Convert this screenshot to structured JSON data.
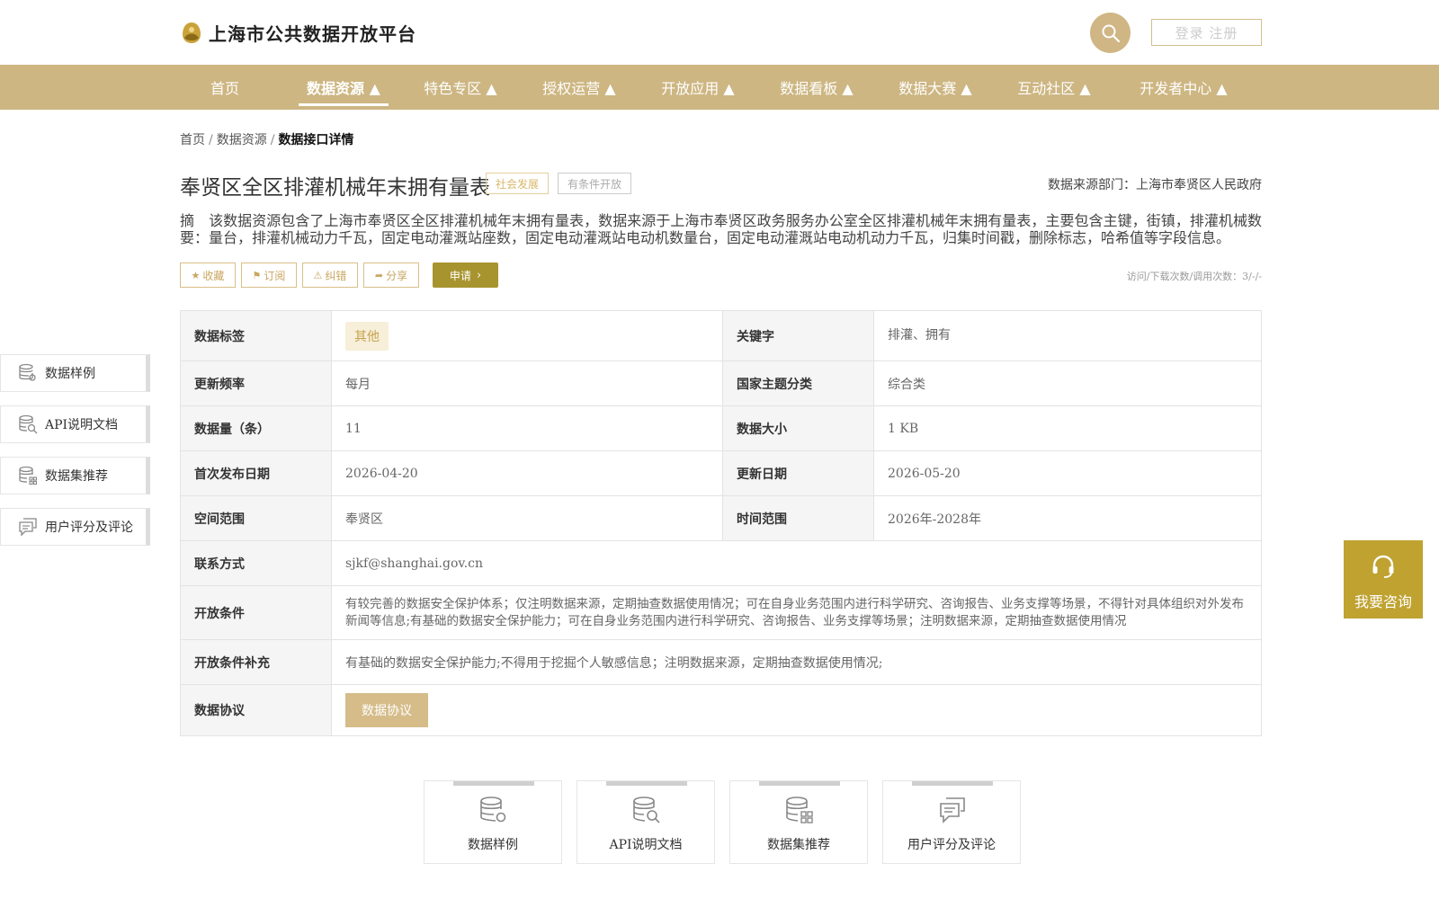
{
  "header": {
    "platform_name": "上海市公共数据开放平台",
    "login_label": "登录 注册"
  },
  "nav": {
    "items": [
      {
        "label": "首页"
      },
      {
        "label": "数据资源 ▲",
        "active": true
      },
      {
        "label": "特色专区 ▲"
      },
      {
        "label": "授权运营 ▲"
      },
      {
        "label": "开放应用 ▲"
      },
      {
        "label": "数据看板 ▲"
      },
      {
        "label": "数据大赛 ▲"
      },
      {
        "label": "互动社区 ▲"
      },
      {
        "label": "开发者中心 ▲"
      }
    ]
  },
  "breadcrumb": {
    "items": [
      "首页",
      "数据资源",
      "数据接口详情"
    ],
    "separator": "/"
  },
  "dataset": {
    "title": "奉贤区全区排灌机械年末拥有量表",
    "tags": [
      "社会发展",
      "有条件开放"
    ],
    "source": "数据来源部门：上海市奉贤区人民政府",
    "abstract": "摘　该数据资源包含了上海市奉贤区全区排灌机械年末拥有量表，数据来源于上海市奉贤区政务服务办公室全区排灌机械年末拥有量表，主要包含主键，街镇，排灌机械数要：量台，排灌机械动力千瓦，固定电动灌溉站座数，固定电动灌溉站电动机数量台，固定电动灌溉站电动机动力千瓦，归集时间戳，删除标志，哈希值等字段信息。"
  },
  "actions": {
    "collect": "收藏",
    "subscribe": "订阅",
    "report": "纠错",
    "share": "分享",
    "apply": "申请",
    "counts": "访问/下载次数/调用次数：3/-/-"
  },
  "side_nav": {
    "items": [
      "数据样例",
      "API说明文档",
      "数据集推荐",
      "用户评分及评论"
    ]
  },
  "details": {
    "labels": {
      "data_tag": "数据标签",
      "keyword": "关键字",
      "frequency": "更新频率",
      "theme": "国家主题分类",
      "count": "数据量（条）",
      "size": "数据大小",
      "first_date": "首次发布日期",
      "update_date": "更新日期",
      "space": "空间范围",
      "time": "时间范围",
      "contact": "联系方式",
      "conditions": "开放条件",
      "conditions_extra": "开放条件补充",
      "agreement": "数据协议"
    },
    "values": {
      "data_tag": "其他",
      "keyword": "排灌、拥有",
      "frequency": "每月",
      "theme": "综合类",
      "count": "11",
      "size": "1 KB",
      "first_date": "2026-04-20",
      "update_date": "2026-05-20",
      "space": "奉贤区",
      "time": "2026年-2028年",
      "contact": "sjkf@shanghai.gov.cn",
      "conditions": "有较完善的数据安全保护体系；仅注明数据来源，定期抽查数据使用情况；可在自身业务范围内进行科学研究、咨询报告、业务支撑等场景，不得针对具体组织对外发布新闻等信息;有基础的数据安全保护能力；可在自身业务范围内进行科学研究、咨询报告、业务支撑等场景；注明数据来源，定期抽查数据使用情况",
      "conditions_extra": "有基础的数据安全保护能力;不得用于挖掘个人敏感信息；注明数据来源，定期抽查数据使用情况;",
      "agreement_button": "数据协议"
    }
  },
  "bottom_cards": {
    "items": [
      "数据样例",
      "API说明文档",
      "数据集推荐",
      "用户评分及评论"
    ]
  },
  "consult": {
    "label": "我要咨询"
  },
  "colors": {
    "brand": "#cdb682",
    "accent_dark": "#a8942e",
    "consult": "#bfa230"
  }
}
